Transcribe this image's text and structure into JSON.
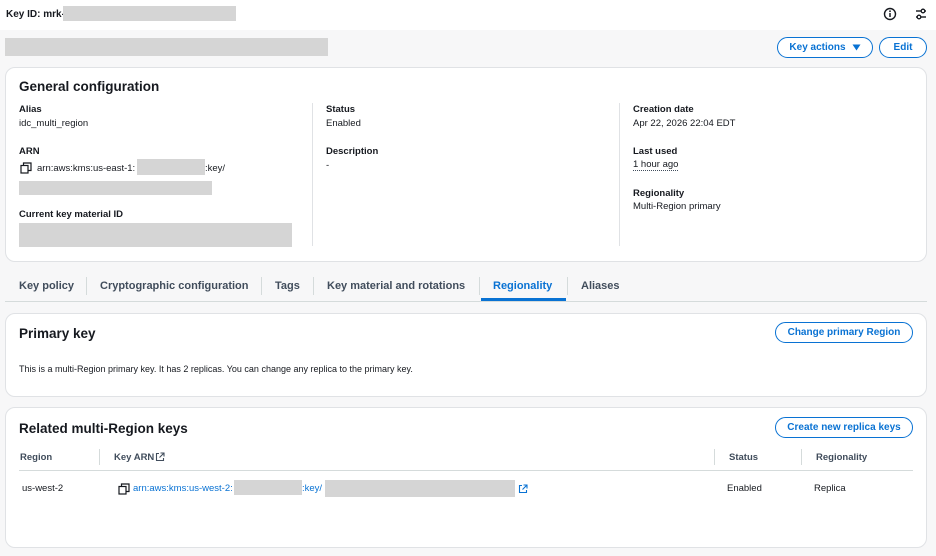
{
  "header": {
    "key_id_label": "Key ID: mrk-"
  },
  "actions": {
    "key_actions": "Key actions",
    "edit": "Edit"
  },
  "general": {
    "title": "General configuration",
    "alias_label": "Alias",
    "alias_value": "idc_multi_region",
    "arn_label": "ARN",
    "arn_prefix": "arn:aws:kms:us-east-1:",
    "arn_mid": ":key/",
    "material_label": "Current key material ID",
    "status_label": "Status",
    "status_value": "Enabled",
    "description_label": "Description",
    "description_value": "-",
    "creation_label": "Creation date",
    "creation_value": "Apr 22, 2026 22:04 EDT",
    "last_used_label": "Last used",
    "last_used_value": "1 hour ago",
    "regionality_label": "Regionality",
    "regionality_value": "Multi-Region primary"
  },
  "tabs": [
    "Key policy",
    "Cryptographic configuration",
    "Tags",
    "Key material and rotations",
    "Regionality",
    "Aliases"
  ],
  "primary": {
    "title": "Primary key",
    "button": "Change primary Region",
    "text": "This is a multi-Region primary key. It has 2 replicas. You can change any replica to the primary key."
  },
  "related": {
    "title": "Related multi-Region keys",
    "button": "Create new replica keys",
    "columns": [
      "Region",
      "Key ARN",
      "Status",
      "Regionality"
    ],
    "row": {
      "region": "us-west-2",
      "arn_prefix": "arn:aws:kms:us-west-2:",
      "arn_mid": ":key/",
      "status": "Enabled",
      "regionality": "Replica"
    }
  },
  "colors": {
    "accent": "#0972d3",
    "text": "#16191f",
    "redacted": "#d5d5d5"
  },
  "icons": [
    "info-icon",
    "settings-icon",
    "caret-down-icon",
    "copy-icon",
    "external-link-icon"
  ]
}
